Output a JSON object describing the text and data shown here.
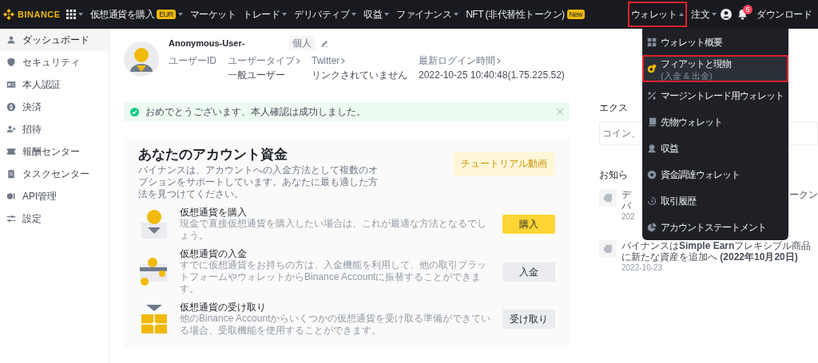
{
  "navbar": {
    "logo": "BINANCE",
    "left_items": [
      {
        "kind": "apps",
        "dropdown": true
      },
      {
        "kind": "text",
        "label": "仮想通貨を購入",
        "badge": "EUR",
        "dropdown": true
      },
      {
        "kind": "text",
        "label": "マーケット",
        "dropdown": false
      },
      {
        "kind": "text",
        "label": "トレード",
        "dropdown": true
      },
      {
        "kind": "text",
        "label": "デリバティブ",
        "dropdown": true
      },
      {
        "kind": "text",
        "label": "収益",
        "dropdown": true
      },
      {
        "kind": "text",
        "label": "ファイナンス",
        "dropdown": true
      },
      {
        "kind": "text",
        "label": "NFT (非代替性トークン)",
        "badge": "New",
        "dropdown": false
      }
    ],
    "right_items": [
      {
        "kind": "text",
        "label": "ウォレット",
        "dropdown": true,
        "expanded": true,
        "highlighted": true
      },
      {
        "kind": "text",
        "label": "注文",
        "dropdown": true,
        "expanded": false,
        "highlighted": false
      },
      {
        "kind": "user"
      },
      {
        "kind": "bell",
        "badge": "5"
      },
      {
        "kind": "text",
        "label": "ダウンロード",
        "dropdown": false,
        "highlighted": false
      }
    ]
  },
  "sidebar": {
    "items": [
      {
        "label": "ダッシュボード",
        "selected": true
      },
      {
        "label": "セキュリティ",
        "selected": false
      },
      {
        "label": "本人認証",
        "selected": false
      },
      {
        "label": "決済",
        "selected": false
      },
      {
        "label": "招待",
        "selected": false
      },
      {
        "label": "報酬センター",
        "selected": false
      },
      {
        "label": "タスクセンター",
        "selected": false
      },
      {
        "label": "API管理",
        "selected": false
      },
      {
        "label": "設定",
        "selected": false
      }
    ]
  },
  "profile": {
    "name": "Anonymous-User-",
    "tag": "個人",
    "fields": [
      {
        "label": "ユーザーID",
        "link": false
      },
      {
        "label": "ユーザータイプ",
        "link": true,
        "value": "一般ユーザー"
      },
      {
        "label": "Twitter",
        "link": true,
        "value": "リンクされていません"
      },
      {
        "label": "最新ログイン時間",
        "link": true,
        "value": "2022-10-25 10:40:48(1.75.225.52)"
      }
    ]
  },
  "alert": {
    "text": "おめでとうございます、本人確認は成功しました。",
    "dismissible": true
  },
  "funds": {
    "title": "あなたのアカウント資金",
    "description": "バイナンスは、アカウントへの入金方法として複数のオプションをサポートしています。あなたに最も適した方法を見つけてください。",
    "tutorial_button": "チュートリアル動画",
    "methods": [
      {
        "kind": "buy",
        "title": "仮想通貨を購入",
        "description": "現金で直接仮想通貨を購入したい場合は、これが最適な方法となるでしょう。",
        "button": "購入",
        "primary": true
      },
      {
        "kind": "deposit",
        "title": "仮想通貨の入金",
        "description": "すでに仮想通貨をお持ちの方は、入金機能を利用して、他の取引プラットフォームやウォレットからBinance Accountに振替することができます。",
        "button": "入金",
        "primary": false
      },
      {
        "kind": "receive",
        "title": "仮想通貨の受け取り",
        "description": "他のBinance Accountからいくつかの仮想通貨を受け取る準備ができている場合、受取機能を使用することができます。",
        "button": "受け取り",
        "primary": false
      }
    ]
  },
  "explore": {
    "heading": "エクス",
    "search_placeholder": "コイン、"
  },
  "announcements": {
    "heading": "お知ら",
    "items": [
      {
        "kind": "covered",
        "left_lines": [
          "デ",
          "パ"
        ],
        "right_text": "ークン",
        "date": "202"
      },
      {
        "kind": "full",
        "title": "バイナンスは**Simple Earn**フレキシブル商品に新たな資産を追加へ **(2022年10月20日)**",
        "date": "2022-10-23"
      }
    ]
  },
  "wallet_menu": {
    "items": [
      {
        "label": "ウォレット概要",
        "selected": false,
        "highlighted": false
      },
      {
        "label": "フィアットと現物",
        "sub": "(入金 & 出金)",
        "selected": true,
        "highlighted": true
      },
      {
        "label": "マージントレード用ウォレット",
        "selected": false,
        "highlighted": false
      },
      {
        "label": "先物ウォレット",
        "selected": false,
        "highlighted": false
      },
      {
        "label": "収益",
        "selected": false,
        "highlighted": false
      },
      {
        "label": "資金調達ウォレット",
        "selected": false,
        "highlighted": false
      },
      {
        "label": "取引履歴",
        "selected": false,
        "highlighted": false
      },
      {
        "label": "アカウントステートメント",
        "selected": false,
        "highlighted": false
      }
    ]
  }
}
